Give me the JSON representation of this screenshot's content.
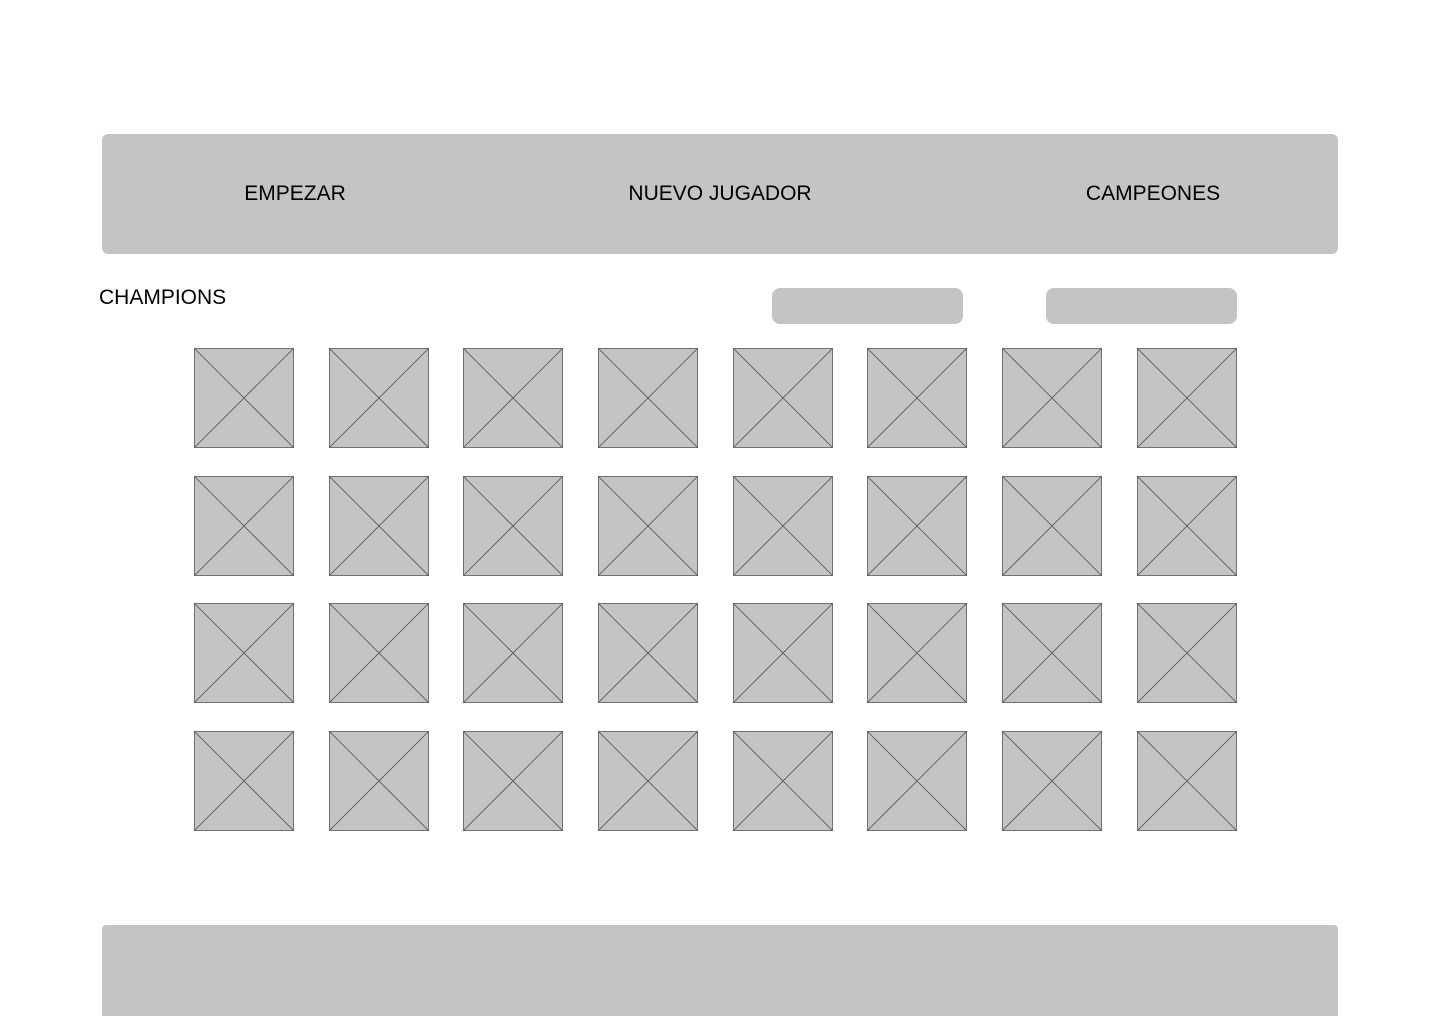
{
  "nav": {
    "start_label": "EMPEZAR",
    "new_player_label": "NUEVO JUGADOR",
    "champions_label": "CAMPEONES"
  },
  "section": {
    "title": "CHAMPIONS"
  },
  "filters": {
    "first_value": "",
    "second_value": ""
  },
  "grid": {
    "rows": 4,
    "columns": 8,
    "tile_icon": "image-placeholder-icon"
  },
  "colors": {
    "panel": "#c4c4c4",
    "placeholder_stroke": "#555555",
    "text": "#000000",
    "background": "#ffffff"
  }
}
